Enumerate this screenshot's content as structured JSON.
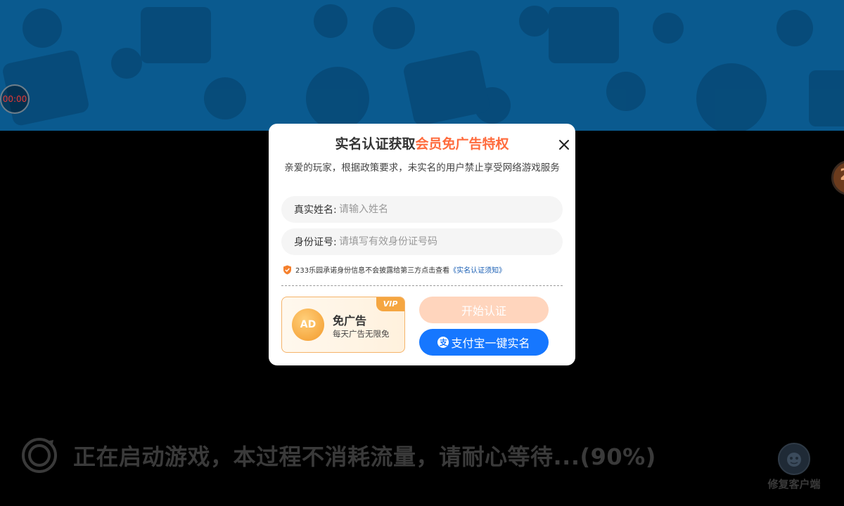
{
  "banner": {
    "timer_text": "00:00"
  },
  "modal": {
    "title_prefix": "实名认证获取",
    "title_highlight": "会员免广告特权",
    "description": "亲爱的玩家，根据政策要求，未实名的用户禁止享受网络游戏服务",
    "name_label": "真实姓名:",
    "name_placeholder": "请输入姓名",
    "id_label": "身份证号:",
    "id_placeholder": "请填写有效身份证号码",
    "notice_text": "233乐园承诺身份信息不会披露给第三方点击查看",
    "notice_link": "《实名认证须知》",
    "vip": {
      "badge": "VIP",
      "icon_text": "AD",
      "title": "免广告",
      "subtitle": "每天广告无限免"
    },
    "start_button": "开始认证",
    "alipay_icon": "支",
    "alipay_button": "支付宝一键实名"
  },
  "loading_text": "正在启动游戏，本过程不消耗流量，请耐心等待...(90%)",
  "repair_label": "修复客户端",
  "colors": {
    "highlight": "#ff6b3d",
    "alipay_blue": "#1677ff",
    "start_button_bg": "#ffd5bd",
    "banner_bg": "#0a5a8f"
  }
}
